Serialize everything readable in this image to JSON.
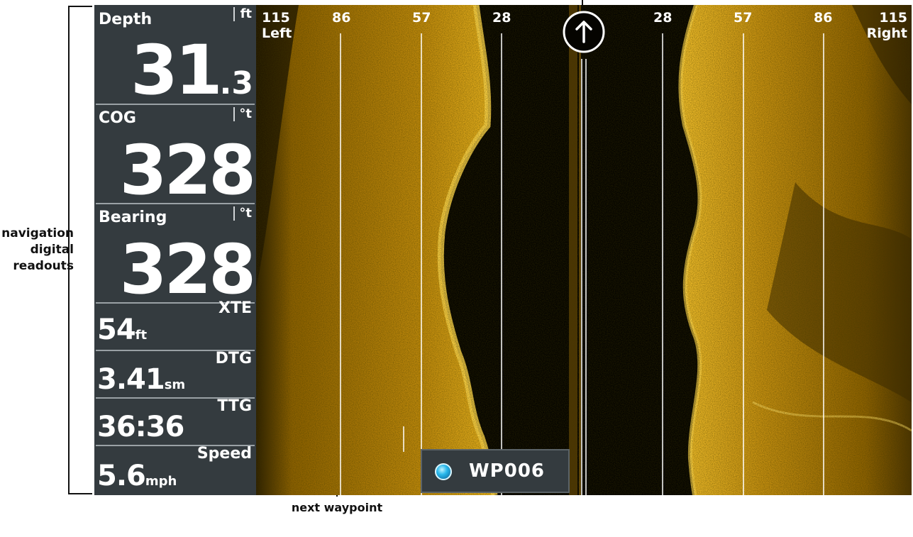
{
  "annotations": {
    "left_label": [
      "navigation",
      "digital",
      "readouts"
    ],
    "bottom_label": "next waypoint"
  },
  "readouts": {
    "depth": {
      "label": "Depth",
      "unit": "ft",
      "value_int": "31",
      "value_dec": ".3"
    },
    "cog": {
      "label": "COG",
      "unit": "°t",
      "value": "328"
    },
    "bearing": {
      "label": "Bearing",
      "unit": "°t",
      "value": "328"
    },
    "xte": {
      "label": "XTE",
      "value": "54",
      "unit": "ft"
    },
    "dtg": {
      "label": "DTG",
      "value": "3.41",
      "unit": "sm"
    },
    "ttg": {
      "label": "TTG",
      "value": "36:36"
    },
    "speed": {
      "label": "Speed",
      "value": "5.6",
      "unit": "mph"
    }
  },
  "range_scale": {
    "left": [
      "115",
      "86",
      "57",
      "28"
    ],
    "right": [
      "28",
      "57",
      "86",
      "115"
    ],
    "left_caption": "Left",
    "right_caption": "Right"
  },
  "waypoint": {
    "name": "WP006"
  },
  "icons": {
    "heading": "north-arrow-icon",
    "waypoint": "waypoint-marker-icon"
  },
  "colors": {
    "sonar_gold": "#e0a81a",
    "panel": "#343b3f",
    "water": "#050400"
  }
}
